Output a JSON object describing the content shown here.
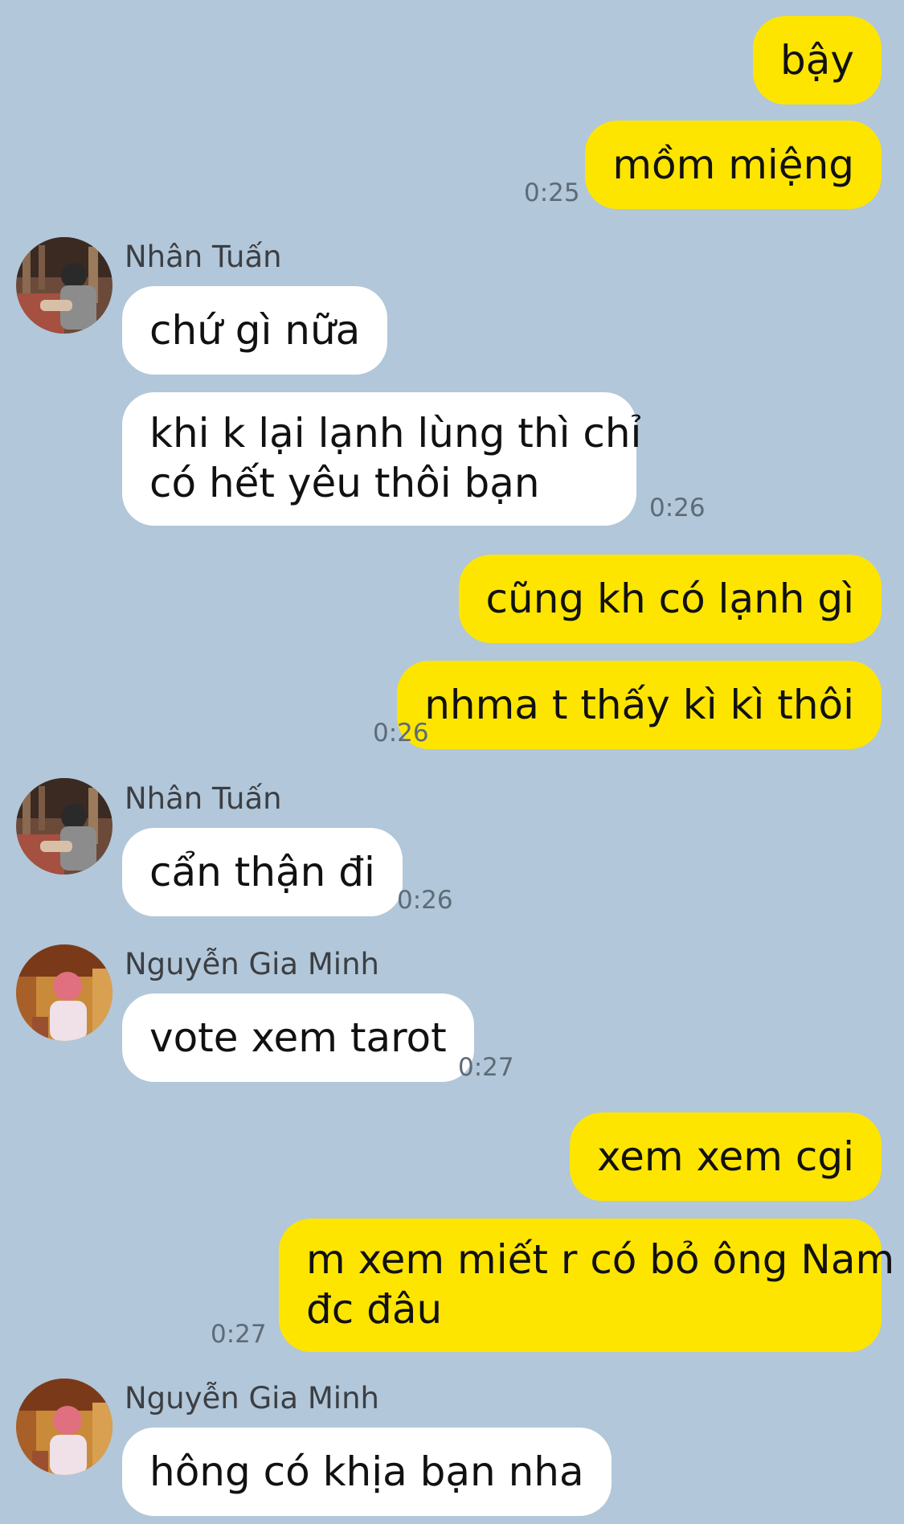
{
  "colors": {
    "background": "#b2c7d9",
    "outgoing_bubble": "#fee500",
    "incoming_bubble": "#ffffff"
  },
  "messages": [
    {
      "direction": "out",
      "text": "bậy"
    },
    {
      "direction": "out",
      "text": "mồm miệng",
      "time": "0:25"
    },
    {
      "direction": "in",
      "sender": "Nhân Tuấn",
      "text": "chứ gì nữa"
    },
    {
      "direction": "in",
      "text": "khi k lại lạnh lùng thì chỉ có hết yêu thôi bạn",
      "lines": [
        "khi k lại lạnh lùng thì chỉ",
        "có hết yêu thôi bạn"
      ],
      "time": "0:26"
    },
    {
      "direction": "out",
      "text": "cũng kh có lạnh gì"
    },
    {
      "direction": "out",
      "text": "nhma t thấy kì kì thôi",
      "time": "0:26"
    },
    {
      "direction": "in",
      "sender": "Nhân Tuấn",
      "text": "cẩn thận đi",
      "time": "0:26"
    },
    {
      "direction": "in",
      "sender": "Nguyễn Gia Minh",
      "text": "vote xem tarot",
      "time": "0:27"
    },
    {
      "direction": "out",
      "text": "xem xem cgi"
    },
    {
      "direction": "out",
      "text": "m xem miết r có bỏ ông Nam đc đâu",
      "lines": [
        "m xem miết r có bỏ ông Nam",
        "đc đâu"
      ],
      "time": "0:27"
    },
    {
      "direction": "in",
      "sender": "Nguyễn Gia Minh",
      "text": "hông có khịa bạn nha"
    }
  ]
}
